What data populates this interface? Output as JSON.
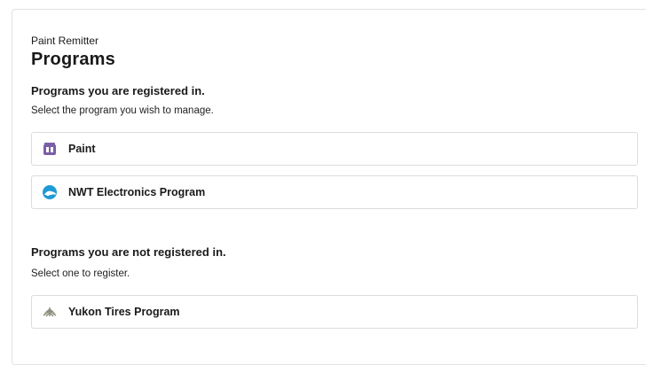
{
  "header": {
    "eyebrow": "Paint Remitter",
    "title": "Programs"
  },
  "registered": {
    "heading": "Programs you are registered in.",
    "description": "Select the program you wish to manage.",
    "programs": [
      {
        "label": "Paint",
        "icon": "paint-can-icon",
        "icon_color": "#7b5ea7"
      },
      {
        "label": "NWT Electronics Program",
        "icon": "bear-logo-icon",
        "icon_color": "#1f9ad6"
      }
    ]
  },
  "unregistered": {
    "heading": "Programs you are not registered in.",
    "description": "Select one to register.",
    "programs": [
      {
        "label": "Yukon Tires Program",
        "icon": "spruce-logo-icon",
        "icon_color": "#8a8a7a"
      }
    ]
  }
}
